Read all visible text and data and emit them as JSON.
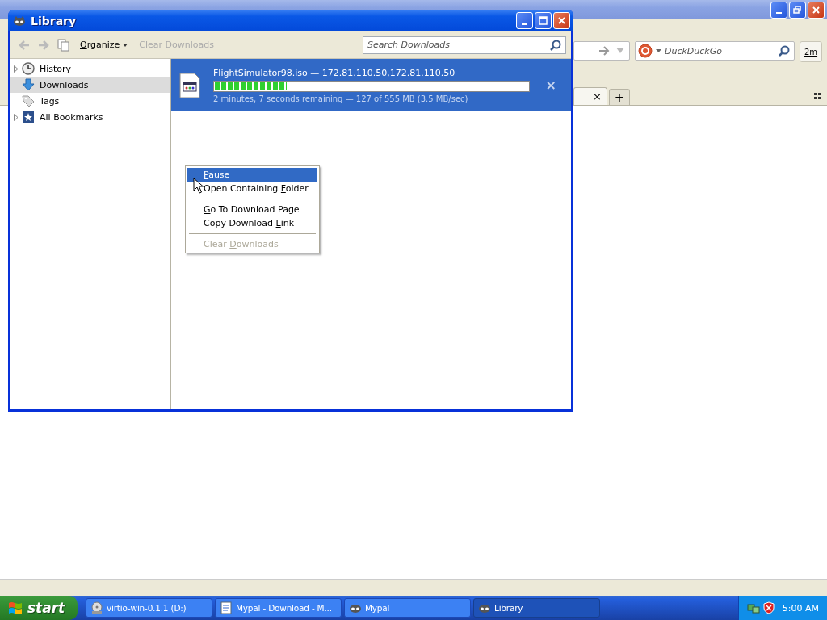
{
  "browser": {
    "search": {
      "placeholder": "DuckDuckGo"
    },
    "downloads_button": "2m",
    "tab_close": "×",
    "new_tab": "+"
  },
  "library": {
    "title": "Library",
    "toolbar": {
      "organize": {
        "key": "O",
        "post": "rganize"
      },
      "clear_downloads": {
        "label": "Clear Downloads",
        "disabled": true
      }
    },
    "search": {
      "placeholder": "Search Downloads"
    },
    "sidebar": [
      {
        "label": "History",
        "kind": "history",
        "expandable": true,
        "selected": false
      },
      {
        "label": "Downloads",
        "kind": "downloads",
        "expandable": false,
        "selected": true
      },
      {
        "label": "Tags",
        "kind": "tags",
        "expandable": false,
        "selected": false
      },
      {
        "label": "All Bookmarks",
        "kind": "bookmarks",
        "expandable": true,
        "selected": false
      }
    ],
    "downloads": [
      {
        "name": "FlightSimulator98.iso — 172.81.110.50,172.81.110.50",
        "level": 0.23,
        "status": "2 minutes, 7 seconds remaining — 127 of 555 MB (3.5 MB/sec)",
        "selected": true,
        "cancel": "×"
      }
    ]
  },
  "context_menu": {
    "items": [
      {
        "kind": "item",
        "key": "P",
        "post": "ause",
        "selected": true,
        "disabled": false
      },
      {
        "kind": "item",
        "pre": "Open Containing ",
        "key": "F",
        "post": "older",
        "selected": false,
        "disabled": false
      },
      {
        "kind": "separator"
      },
      {
        "kind": "item",
        "key": "G",
        "post": "o To Download Page",
        "selected": false,
        "disabled": false
      },
      {
        "kind": "item",
        "pre": "Copy Download ",
        "key": "L",
        "post": "ink",
        "selected": false,
        "disabled": false
      },
      {
        "kind": "separator"
      },
      {
        "kind": "item",
        "pre": "Clear ",
        "key": "D",
        "post": "ownloads",
        "selected": false,
        "disabled": true
      }
    ]
  },
  "taskbar": {
    "start": "start",
    "items": [
      {
        "label": "virtio-win-0.1.1 (D:)",
        "kind": "drive",
        "selected": false
      },
      {
        "label": "Mypal - Download - M...",
        "kind": "page",
        "selected": false
      },
      {
        "label": "Mypal",
        "kind": "app",
        "selected": false
      },
      {
        "label": "Library",
        "kind": "app",
        "selected": true
      }
    ],
    "clock": "5:00 AM"
  }
}
